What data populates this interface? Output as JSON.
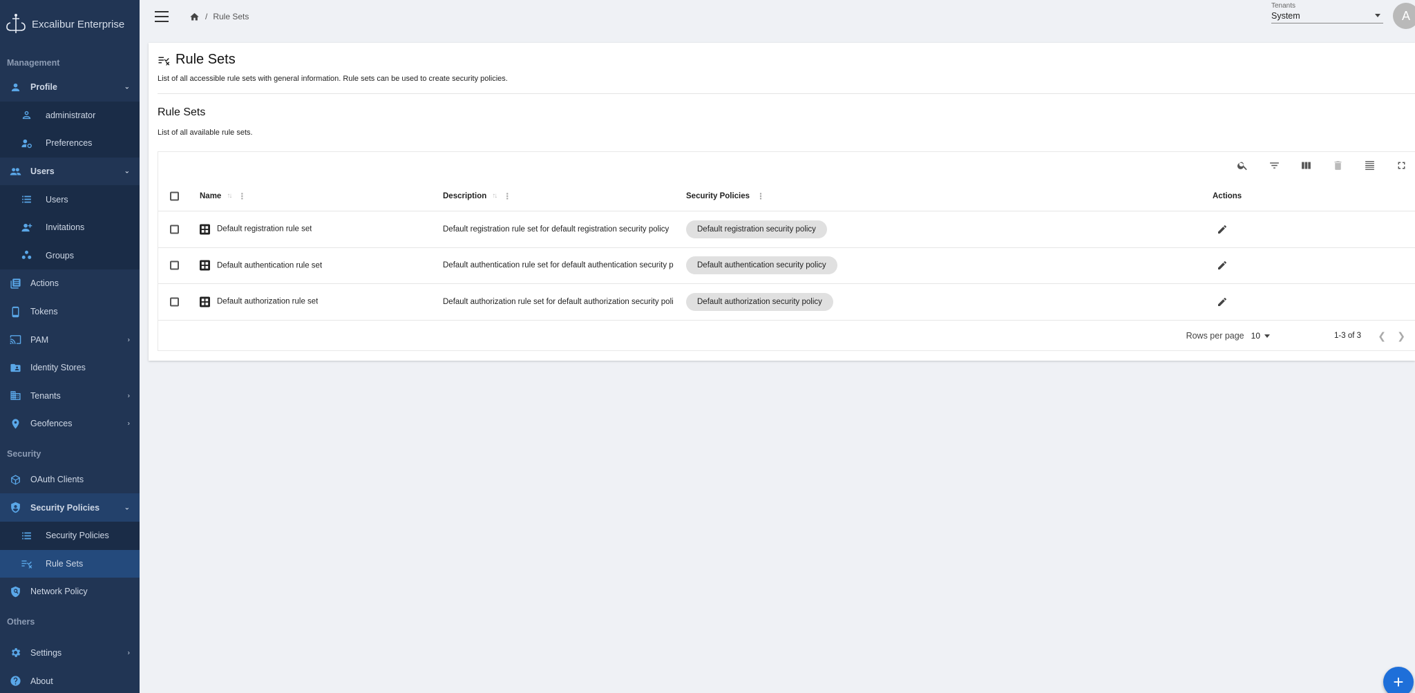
{
  "brand": {
    "name": "Excalibur Enterprise"
  },
  "sidebar": {
    "sections": {
      "management": "Management",
      "security": "Security",
      "others": "Others"
    },
    "items": {
      "profile": "Profile",
      "administrator": "administrator",
      "preferences": "Preferences",
      "users": "Users",
      "users_list": "Users",
      "invitations": "Invitations",
      "groups": "Groups",
      "actions": "Actions",
      "tokens": "Tokens",
      "pam": "PAM",
      "identity_stores": "Identity Stores",
      "tenants": "Tenants",
      "geofences": "Geofences",
      "oauth_clients": "OAuth Clients",
      "security_policies": "Security Policies",
      "security_policies_list": "Security Policies",
      "rule_sets": "Rule Sets",
      "network_policy": "Network Policy",
      "settings": "Settings",
      "about": "About"
    }
  },
  "topbar": {
    "breadcrumb_sep": "/",
    "breadcrumb_current": "Rule Sets",
    "tenant_label": "Tenants",
    "tenant_value": "System",
    "avatar_letter": "A"
  },
  "page": {
    "title": "Rule Sets",
    "description": "List of all accessible rule sets with general information. Rule sets can be used to create security policies.",
    "section_title": "Rule Sets",
    "section_description": "List of all available rule sets."
  },
  "table": {
    "columns": {
      "name": "Name",
      "description": "Description",
      "security_policies": "Security Policies",
      "actions": "Actions"
    },
    "rows": [
      {
        "name": "Default registration rule set",
        "description": "Default registration rule set for default registration security policy",
        "policy": "Default registration security policy"
      },
      {
        "name": "Default authentication rule set",
        "description": "Default authentication rule set for default authentication security p",
        "policy": "Default authentication security policy"
      },
      {
        "name": "Default authorization rule set",
        "description": "Default authorization rule set for default authorization security poli",
        "policy": "Default authorization security policy"
      }
    ],
    "footer": {
      "rows_per_page_label": "Rows per page",
      "rows_per_page_value": "10",
      "range": "1-3 of 3"
    }
  },
  "fab": {
    "label": "+"
  },
  "colors": {
    "sidebar_bg": "#213554",
    "accent_icon": "#5aa7e8",
    "fab": "#1e6fd9"
  }
}
